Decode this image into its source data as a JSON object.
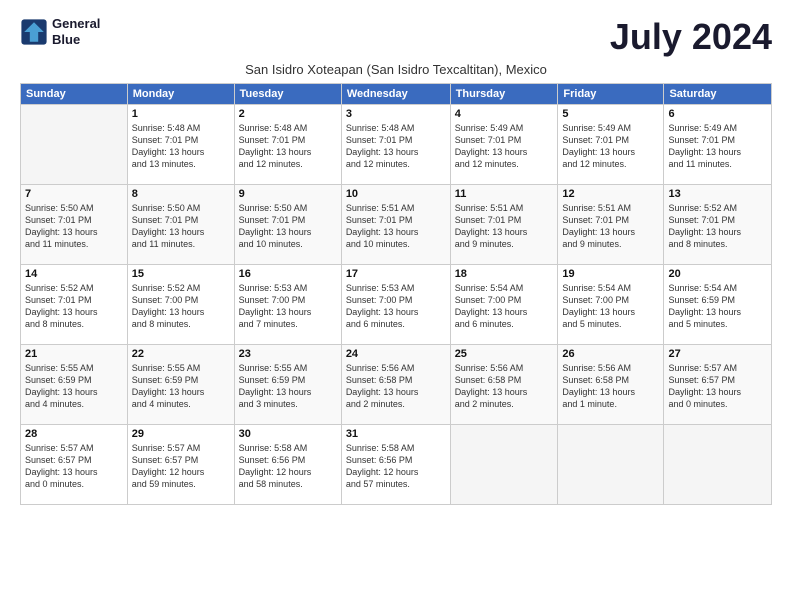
{
  "header": {
    "logo_line1": "General",
    "logo_line2": "Blue",
    "month_title": "July 2024",
    "subtitle": "San Isidro Xoteapan (San Isidro Texcaltitan), Mexico"
  },
  "weekdays": [
    "Sunday",
    "Monday",
    "Tuesday",
    "Wednesday",
    "Thursday",
    "Friday",
    "Saturday"
  ],
  "weeks": [
    [
      {
        "day": "",
        "info": ""
      },
      {
        "day": "1",
        "info": "Sunrise: 5:48 AM\nSunset: 7:01 PM\nDaylight: 13 hours\nand 13 minutes."
      },
      {
        "day": "2",
        "info": "Sunrise: 5:48 AM\nSunset: 7:01 PM\nDaylight: 13 hours\nand 12 minutes."
      },
      {
        "day": "3",
        "info": "Sunrise: 5:48 AM\nSunset: 7:01 PM\nDaylight: 13 hours\nand 12 minutes."
      },
      {
        "day": "4",
        "info": "Sunrise: 5:49 AM\nSunset: 7:01 PM\nDaylight: 13 hours\nand 12 minutes."
      },
      {
        "day": "5",
        "info": "Sunrise: 5:49 AM\nSunset: 7:01 PM\nDaylight: 13 hours\nand 12 minutes."
      },
      {
        "day": "6",
        "info": "Sunrise: 5:49 AM\nSunset: 7:01 PM\nDaylight: 13 hours\nand 11 minutes."
      }
    ],
    [
      {
        "day": "7",
        "info": "Sunrise: 5:50 AM\nSunset: 7:01 PM\nDaylight: 13 hours\nand 11 minutes."
      },
      {
        "day": "8",
        "info": "Sunrise: 5:50 AM\nSunset: 7:01 PM\nDaylight: 13 hours\nand 11 minutes."
      },
      {
        "day": "9",
        "info": "Sunrise: 5:50 AM\nSunset: 7:01 PM\nDaylight: 13 hours\nand 10 minutes."
      },
      {
        "day": "10",
        "info": "Sunrise: 5:51 AM\nSunset: 7:01 PM\nDaylight: 13 hours\nand 10 minutes."
      },
      {
        "day": "11",
        "info": "Sunrise: 5:51 AM\nSunset: 7:01 PM\nDaylight: 13 hours\nand 9 minutes."
      },
      {
        "day": "12",
        "info": "Sunrise: 5:51 AM\nSunset: 7:01 PM\nDaylight: 13 hours\nand 9 minutes."
      },
      {
        "day": "13",
        "info": "Sunrise: 5:52 AM\nSunset: 7:01 PM\nDaylight: 13 hours\nand 8 minutes."
      }
    ],
    [
      {
        "day": "14",
        "info": "Sunrise: 5:52 AM\nSunset: 7:01 PM\nDaylight: 13 hours\nand 8 minutes."
      },
      {
        "day": "15",
        "info": "Sunrise: 5:52 AM\nSunset: 7:00 PM\nDaylight: 13 hours\nand 8 minutes."
      },
      {
        "day": "16",
        "info": "Sunrise: 5:53 AM\nSunset: 7:00 PM\nDaylight: 13 hours\nand 7 minutes."
      },
      {
        "day": "17",
        "info": "Sunrise: 5:53 AM\nSunset: 7:00 PM\nDaylight: 13 hours\nand 6 minutes."
      },
      {
        "day": "18",
        "info": "Sunrise: 5:54 AM\nSunset: 7:00 PM\nDaylight: 13 hours\nand 6 minutes."
      },
      {
        "day": "19",
        "info": "Sunrise: 5:54 AM\nSunset: 7:00 PM\nDaylight: 13 hours\nand 5 minutes."
      },
      {
        "day": "20",
        "info": "Sunrise: 5:54 AM\nSunset: 6:59 PM\nDaylight: 13 hours\nand 5 minutes."
      }
    ],
    [
      {
        "day": "21",
        "info": "Sunrise: 5:55 AM\nSunset: 6:59 PM\nDaylight: 13 hours\nand 4 minutes."
      },
      {
        "day": "22",
        "info": "Sunrise: 5:55 AM\nSunset: 6:59 PM\nDaylight: 13 hours\nand 4 minutes."
      },
      {
        "day": "23",
        "info": "Sunrise: 5:55 AM\nSunset: 6:59 PM\nDaylight: 13 hours\nand 3 minutes."
      },
      {
        "day": "24",
        "info": "Sunrise: 5:56 AM\nSunset: 6:58 PM\nDaylight: 13 hours\nand 2 minutes."
      },
      {
        "day": "25",
        "info": "Sunrise: 5:56 AM\nSunset: 6:58 PM\nDaylight: 13 hours\nand 2 minutes."
      },
      {
        "day": "26",
        "info": "Sunrise: 5:56 AM\nSunset: 6:58 PM\nDaylight: 13 hours\nand 1 minute."
      },
      {
        "day": "27",
        "info": "Sunrise: 5:57 AM\nSunset: 6:57 PM\nDaylight: 13 hours\nand 0 minutes."
      }
    ],
    [
      {
        "day": "28",
        "info": "Sunrise: 5:57 AM\nSunset: 6:57 PM\nDaylight: 13 hours\nand 0 minutes."
      },
      {
        "day": "29",
        "info": "Sunrise: 5:57 AM\nSunset: 6:57 PM\nDaylight: 12 hours\nand 59 minutes."
      },
      {
        "day": "30",
        "info": "Sunrise: 5:58 AM\nSunset: 6:56 PM\nDaylight: 12 hours\nand 58 minutes."
      },
      {
        "day": "31",
        "info": "Sunrise: 5:58 AM\nSunset: 6:56 PM\nDaylight: 12 hours\nand 57 minutes."
      },
      {
        "day": "",
        "info": ""
      },
      {
        "day": "",
        "info": ""
      },
      {
        "day": "",
        "info": ""
      }
    ]
  ]
}
